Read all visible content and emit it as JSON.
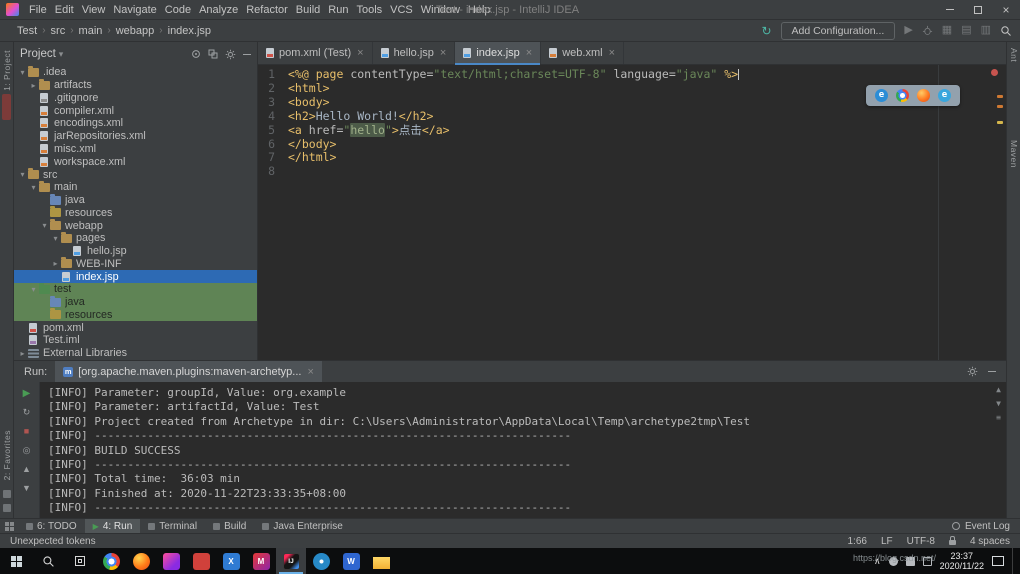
{
  "colors": {
    "panel_bg": "#3c3f41",
    "editor_bg": "#2b2b2b",
    "selection_blue": "#2d6ab4",
    "vcs_green": "#5f8455",
    "tag_yellow": "#e8bf6a",
    "string_green": "#6a8759",
    "run_green": "#499c54",
    "error_red": "#c7544f",
    "warning_yellow": "#d5b64c",
    "active_tab_underline": "#4a88c7"
  },
  "title_bar": {
    "menus": [
      "File",
      "Edit",
      "View",
      "Navigate",
      "Code",
      "Analyze",
      "Refactor",
      "Build",
      "Run",
      "Tools",
      "VCS",
      "Window",
      "Help"
    ],
    "title": "Test - index.jsp - IntelliJ IDEA"
  },
  "nav_bar": {
    "breadcrumbs": [
      "Test",
      "src",
      "main",
      "webapp",
      "index.jsp"
    ],
    "add_configuration": "Add Configuration..."
  },
  "left_stripe": {
    "top_label": "1: Project",
    "bottom_label": "2: Favorites"
  },
  "right_stripe": {
    "labels": [
      "Ant",
      "Maven"
    ]
  },
  "project_panel": {
    "title": "Project",
    "tree": [
      {
        "label": ".idea",
        "indent": 0,
        "icon": "folder",
        "arrow": "open",
        "state": ""
      },
      {
        "label": "artifacts",
        "indent": 1,
        "icon": "folder",
        "arrow": "closed",
        "state": ""
      },
      {
        "label": ".gitignore",
        "indent": 1,
        "icon": "file-git",
        "arrow": "none",
        "state": ""
      },
      {
        "label": "compiler.xml",
        "indent": 1,
        "icon": "file-xml",
        "arrow": "none",
        "state": ""
      },
      {
        "label": "encodings.xml",
        "indent": 1,
        "icon": "file-xml",
        "arrow": "none",
        "state": ""
      },
      {
        "label": "jarRepositories.xml",
        "indent": 1,
        "icon": "file-xml",
        "arrow": "none",
        "state": ""
      },
      {
        "label": "misc.xml",
        "indent": 1,
        "icon": "file-xml",
        "arrow": "none",
        "state": ""
      },
      {
        "label": "workspace.xml",
        "indent": 1,
        "icon": "file-xml",
        "arrow": "none",
        "state": ""
      },
      {
        "label": "src",
        "indent": 0,
        "icon": "folder",
        "arrow": "open",
        "state": ""
      },
      {
        "label": "main",
        "indent": 1,
        "icon": "folder",
        "arrow": "open",
        "state": ""
      },
      {
        "label": "java",
        "indent": 2,
        "icon": "folder-src",
        "arrow": "none",
        "state": ""
      },
      {
        "label": "resources",
        "indent": 2,
        "icon": "folder-res",
        "arrow": "none",
        "state": ""
      },
      {
        "label": "webapp",
        "indent": 2,
        "icon": "folder",
        "arrow": "open",
        "state": ""
      },
      {
        "label": "pages",
        "indent": 3,
        "icon": "folder",
        "arrow": "open",
        "state": ""
      },
      {
        "label": "hello.jsp",
        "indent": 4,
        "ic": "",
        "icon": "file-jsp",
        "arrow": "none",
        "state": ""
      },
      {
        "label": "WEB-INF",
        "indent": 3,
        "icon": "folder",
        "arrow": "closed",
        "state": ""
      },
      {
        "label": "index.jsp",
        "indent": 3,
        "icon": "file-jsp",
        "arrow": "none",
        "state": "selected"
      },
      {
        "label": "test",
        "indent": 1,
        "icon": "folder-test",
        "arrow": "open",
        "state": "green"
      },
      {
        "label": "java",
        "indent": 2,
        "icon": "folder-src",
        "arrow": "none",
        "state": "green"
      },
      {
        "label": "resources",
        "indent": 2,
        "icon": "folder-res",
        "arrow": "none",
        "state": "green"
      },
      {
        "label": "pom.xml",
        "indent": 0,
        "icon": "file-maven",
        "arrow": "none",
        "state": ""
      },
      {
        "label": "Test.iml",
        "indent": 0,
        "icon": "file-iml",
        "arrow": "none",
        "state": ""
      },
      {
        "label": "External Libraries",
        "indent": 0,
        "icon": "libs",
        "arrow": "closed",
        "state": ""
      }
    ]
  },
  "editor": {
    "tabs": [
      {
        "label": "pom.xml (Test)",
        "icon": "maven",
        "active": false
      },
      {
        "label": "hello.jsp",
        "icon": "jsp",
        "active": false
      },
      {
        "label": "index.jsp",
        "icon": "jsp",
        "active": true
      },
      {
        "label": "web.xml",
        "icon": "xml",
        "active": false
      }
    ],
    "browser_popup": [
      {
        "id": "edge",
        "letter": "e"
      },
      {
        "id": "chrome",
        "letter": ""
      },
      {
        "id": "firefox",
        "letter": ""
      },
      {
        "id": "ie",
        "letter": "e"
      }
    ],
    "lines": [
      {
        "n": 1,
        "caret": true,
        "tokens": [
          {
            "t": "<%@ page ",
            "c": "tag"
          },
          {
            "t": "contentType=",
            "c": "attr"
          },
          {
            "t": "\"text/html;charset=UTF-8\"",
            "c": "str"
          },
          {
            "t": " ",
            "c": "txt"
          },
          {
            "t": "language=",
            "c": "attr"
          },
          {
            "t": "\"java\"",
            "c": "str"
          },
          {
            "t": " %>",
            "c": "tag"
          }
        ]
      },
      {
        "n": 2,
        "tokens": [
          {
            "t": "<html>",
            "c": "tag"
          }
        ]
      },
      {
        "n": 3,
        "tokens": [
          {
            "t": "<body>",
            "c": "tag"
          }
        ]
      },
      {
        "n": 4,
        "tokens": [
          {
            "t": "<h2>",
            "c": "tag"
          },
          {
            "t": "Hello World!",
            "c": "txt"
          },
          {
            "t": "</h2>",
            "c": "tag"
          }
        ]
      },
      {
        "n": 5,
        "tokens": [
          {
            "t": "<a ",
            "c": "tag"
          },
          {
            "t": "href=",
            "c": "attr"
          },
          {
            "t": "\"",
            "c": "str"
          },
          {
            "t": "hello",
            "c": "strhl"
          },
          {
            "t": "\"",
            "c": "str"
          },
          {
            "t": ">",
            "c": "tag"
          },
          {
            "t": "点击",
            "c": "txt"
          },
          {
            "t": "</a>",
            "c": "tag"
          }
        ]
      },
      {
        "n": 6,
        "tokens": [
          {
            "t": "</body>",
            "c": "tag"
          }
        ]
      },
      {
        "n": 7,
        "tokens": [
          {
            "t": "</html>",
            "c": "tag"
          }
        ]
      },
      {
        "n": 8,
        "tokens": []
      }
    ]
  },
  "run_panel": {
    "run_label": "Run:",
    "tab_label": "[org.apache.maven.plugins:maven-archetyp...",
    "console": [
      "[INFO] Parameter: groupId, Value: org.example",
      "[INFO] Parameter: artifactId, Value: Test",
      "[INFO] Project created from Archetype in dir: C:\\Users\\Administrator\\AppData\\Local\\Temp\\archetype2tmp\\Test",
      "[INFO] ------------------------------------------------------------------------",
      "[INFO] BUILD SUCCESS",
      "[INFO] ------------------------------------------------------------------------",
      "[INFO] Total time:  36:03 min",
      "[INFO] Finished at: 2020-11-22T23:33:35+08:00",
      "[INFO] ------------------------------------------------------------------------"
    ]
  },
  "tool_window_bar": {
    "items": [
      {
        "label": "6: TODO",
        "active": false,
        "run": false
      },
      {
        "label": "4: Run",
        "active": true,
        "run": true
      },
      {
        "label": "Terminal",
        "active": false,
        "run": false
      },
      {
        "label": "Build",
        "active": false,
        "run": false
      },
      {
        "label": "Java Enterprise",
        "active": false,
        "run": false
      }
    ],
    "event_log": "Event Log"
  },
  "status_bar": {
    "message": "Unexpected tokens",
    "caret": "1:66",
    "line_ending": "LF",
    "encoding": "UTF-8",
    "indent": "4 spaces"
  },
  "taskbar": {
    "apps": [
      {
        "id": "chrome",
        "letter": "",
        "active": false
      },
      {
        "id": "firefox",
        "letter": "",
        "active": false
      },
      {
        "id": "purple",
        "letter": "",
        "active": false
      },
      {
        "id": "red",
        "letter": "",
        "active": false
      },
      {
        "id": "blue",
        "letter": "X",
        "active": false
      },
      {
        "id": "m",
        "letter": "M",
        "active": false
      },
      {
        "id": "intellij",
        "letter": "IJ",
        "active": true
      },
      {
        "id": "teal",
        "letter": "",
        "active": false
      },
      {
        "id": "wps",
        "letter": "W",
        "active": false
      },
      {
        "id": "explorer",
        "letter": "",
        "active": false
      }
    ],
    "time": "23:37",
    "date": "2020/11/22"
  },
  "watermark": "https://blog.csdn.net/"
}
